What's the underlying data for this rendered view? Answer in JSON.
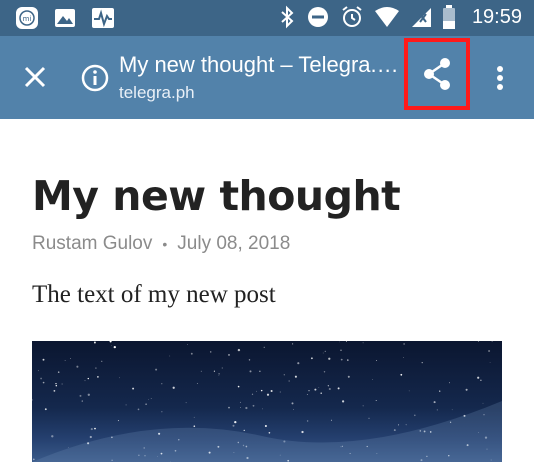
{
  "status_bar": {
    "time": "19:59",
    "left_icons": [
      "mi-app-icon",
      "image-icon",
      "activity-icon"
    ],
    "right_icons": [
      "bluetooth-icon",
      "do-not-disturb-icon",
      "alarm-icon",
      "wifi-icon",
      "signal-icon",
      "battery-icon"
    ]
  },
  "toolbar": {
    "title": "My new thought – Telegra.ph",
    "url": "telegra.ph",
    "close_icon": "close-icon",
    "info_icon": "info-icon",
    "share_icon": "share-icon",
    "more_icon": "more-vert-icon"
  },
  "article": {
    "title": "My new thought",
    "author": "Rustam Gulov",
    "separator": "•",
    "date": "July 08, 2018",
    "body": "The text of my new post",
    "image": "starry-night-sky-image"
  },
  "colors": {
    "status_bar": "#3d6587",
    "toolbar": "#5282aa",
    "highlight": "#ff1a1a",
    "title_text": "#222222",
    "meta_text": "#8b8b8b"
  }
}
